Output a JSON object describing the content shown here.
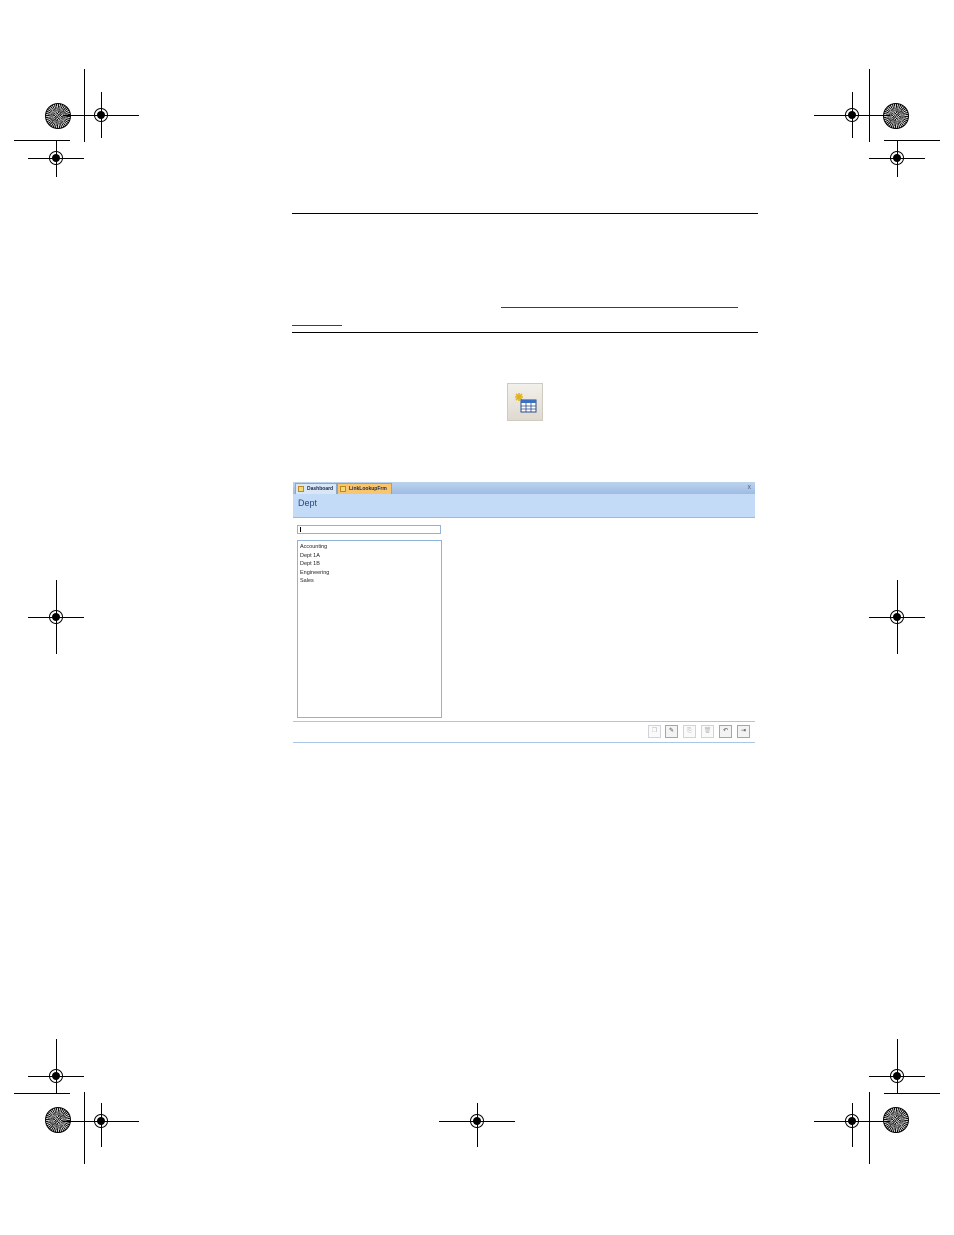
{
  "form": {
    "tabs": [
      {
        "label": "Dashboard",
        "icon": "form-icon"
      },
      {
        "label": "LinkLookupFrm",
        "icon": "form-icon"
      }
    ],
    "close_label": "x",
    "title": "Dept",
    "search": {
      "value": ""
    },
    "list_items": [
      "Accounting",
      "Dept 1A",
      "Dept 1B",
      "Engineering",
      "Sales"
    ],
    "toolbar": [
      {
        "name": "new-record-button",
        "glyph": "❐",
        "enabled": false
      },
      {
        "name": "edit-button",
        "glyph": "✎",
        "enabled": true
      },
      {
        "name": "copy-button",
        "glyph": "⎘",
        "enabled": false
      },
      {
        "name": "delete-button",
        "glyph": "🗑",
        "enabled": false
      },
      {
        "name": "undo-button",
        "glyph": "↶",
        "enabled": true
      },
      {
        "name": "exit-button",
        "glyph": "⇥",
        "enabled": true
      }
    ],
    "colors": {
      "header_bg": "#c3dbf6",
      "active_tab": "#f9c66f",
      "tab_bar": "#9ebbe3"
    }
  }
}
